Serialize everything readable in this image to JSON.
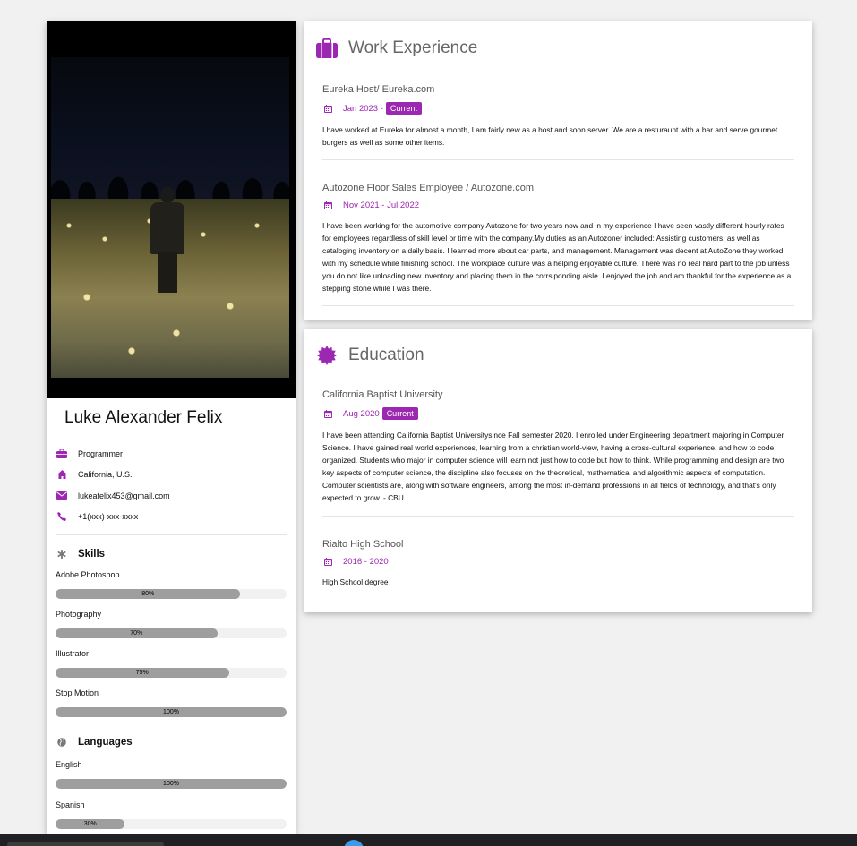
{
  "profile": {
    "name": "Luke Alexander Felix",
    "job": "Programmer",
    "location": "California, U.S.",
    "email": "lukeafelix453@gmail.com",
    "phone": "+1(xxx)-xxx-xxxx"
  },
  "skills": {
    "title": "Skills",
    "items": [
      {
        "label": "Adobe Photoshop",
        "value": "80%",
        "fraction": 0.8
      },
      {
        "label": "Photography",
        "value": "70%",
        "fraction": 0.7
      },
      {
        "label": "Illustrator",
        "value": "75%",
        "fraction": 0.75
      },
      {
        "label": "Stop Motion",
        "value": "100%",
        "fraction": 1.0
      }
    ]
  },
  "languages": {
    "title": "Languages",
    "items": [
      {
        "label": "English",
        "value": "100%",
        "fraction": 1.0
      },
      {
        "label": "Spanish",
        "value": "30%",
        "fraction": 0.3
      }
    ]
  },
  "work": {
    "title": "Work Experience",
    "entries": [
      {
        "title": "Eureka Host/ Eureka.com",
        "date": "Jan 2023 -",
        "tag": "Current",
        "description": "I have worked at Eureka for almost a month, I am fairly new as a host and soon server. We are a resturaunt with a bar and serve gourmet burgers as well as some other items."
      },
      {
        "title": "Autozone Floor Sales Employee / Autozone.com",
        "date": "Nov 2021 - Jul 2022",
        "tag": "",
        "description": "I have been working for the automotive company Autozone for two years now and in my experience I have seen vastly different hourly rates for employees regardless of skill level or time with the company.My duties as an Autozoner included: Assisting customers, as well as cataloging inventory on a daily basis. I learned more about car parts, and management. Management was decent at AutoZone they worked with my schedule while finishing school. The workplace culture was a helping enjoyable culture. There was no real hard part to the job unless you do not like unloading new inventory and placing them in the corrsiponding aisle. I enjoyed the job and am thankful for the experience as a stepping stone while I was there."
      }
    ]
  },
  "education": {
    "title": "Education",
    "entries": [
      {
        "title": "California Baptist University",
        "date": "Aug 2020",
        "tag": "Current",
        "description": "I have been attending California Baptist Universitysince Fall semester 2020. I enrolled under Engineering department majoring in Computer Science. I have gained real world experiences, learning from a christian world-view, having a cross-cultural experience, and how to code organized. Students who major in computer science will learn not just how to code but how to think. While programming and design are two key aspects of computer science, the discipline also focuses on the theoretical, mathematical and algorithmic aspects of computation. Computer scientists are, along with software engineers, among the most in-demand professions in all fields of technology, and that's only expected to grow. - CBU"
      },
      {
        "title": "Rialto High School",
        "date": "2016 - 2020",
        "tag": "",
        "description": "High School degree"
      }
    ]
  },
  "colors": {
    "accent": "#9c27b0",
    "bar_fill": "#9e9e9e",
    "bar_track": "#f1f1f1",
    "background": "#f1f1f1"
  },
  "icons": {
    "job": "briefcase-icon",
    "location": "home-icon",
    "email": "envelope-icon",
    "phone": "phone-icon",
    "skills": "asterisk-icon",
    "languages": "globe-icon",
    "work": "suitcase-icon",
    "education": "certificate-icon",
    "date": "calendar-icon"
  }
}
